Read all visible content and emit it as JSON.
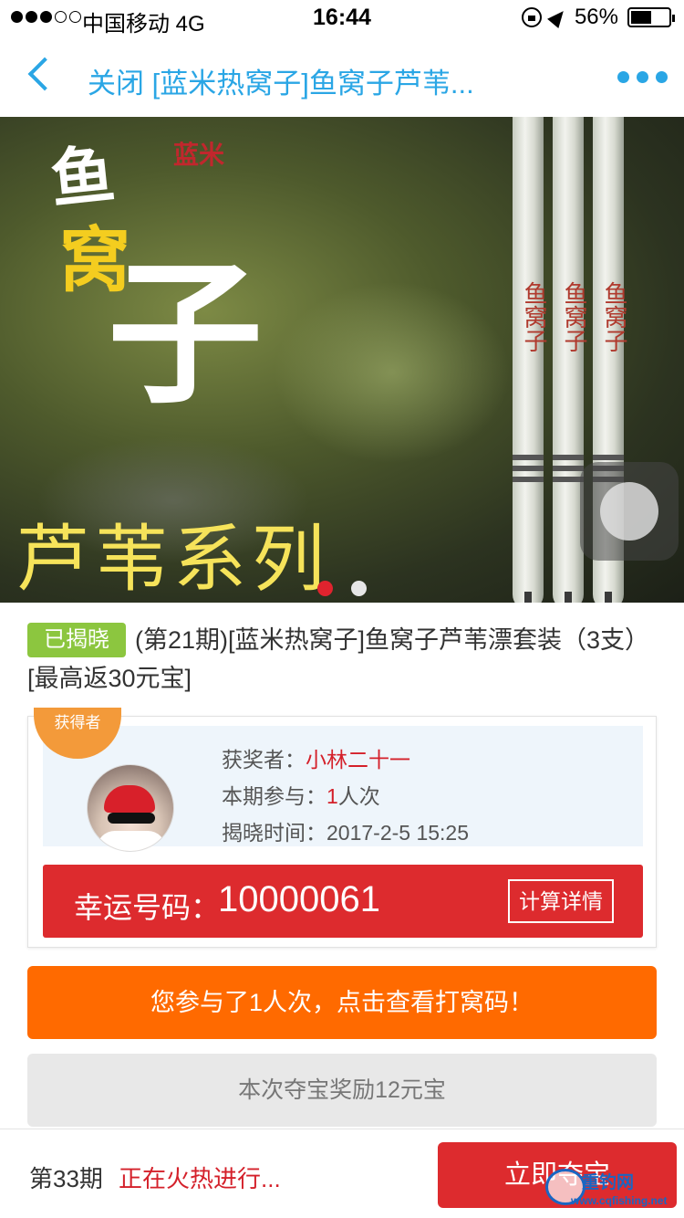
{
  "status_bar": {
    "carrier": "中国移动  4G",
    "time": "16:44",
    "battery": "56%",
    "battery_level": 0.56,
    "signal_full": 3,
    "signal_total": 5
  },
  "nav": {
    "title": "关闭 [蓝米热窝子]鱼窝子芦苇..."
  },
  "hero": {
    "calligraphy_top": "鱼",
    "calligraphy_mid": "窝",
    "calligraphy_big": "子",
    "seal": "蓝米",
    "series_text": "芦苇系列",
    "float_mark": "鱼窝子",
    "slide_count": 2,
    "active_slide": 1
  },
  "product": {
    "status_badge": "已揭晓",
    "title": "(第21期)[蓝米热窝子]鱼窝子芦苇漂套装（3支）[最高返30元宝]"
  },
  "winner": {
    "ribbon": "获得者",
    "winner_label": "获奖者：",
    "winner_name": "小林二十一",
    "participation_label": "本期参与：",
    "participation_count": "1",
    "participation_unit": "人次",
    "reveal_label": "揭晓时间：",
    "reveal_time": "2017-2-5 15:25",
    "lucky_label": "幸运号码：",
    "lucky_number": "10000061",
    "calc_button": "计算详情"
  },
  "participate_button": "您参与了1人次，点击查看打窝码！",
  "reward_text": "本次夺宝奖励12元宝",
  "bottom_bar": {
    "period": "第33期",
    "period_status": "正在火热进行...",
    "join_button": "立即夺宝"
  },
  "watermark": {
    "name": "重钓网",
    "url": "www.cqfishing.net"
  },
  "colors": {
    "accent_blue": "#2aa6e5",
    "red": "#dd2b2e",
    "orange": "#ff6a00",
    "badge_green": "#8cc63f"
  }
}
